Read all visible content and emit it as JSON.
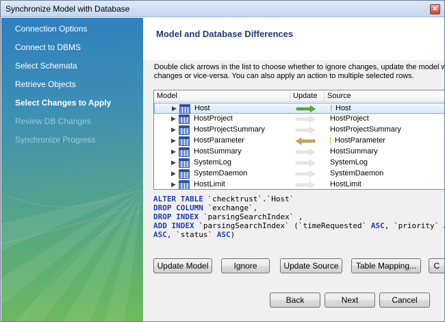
{
  "window": {
    "title": "Synchronize Model with Database",
    "close_glyph": "✕"
  },
  "sidebar": {
    "steps": [
      {
        "label": "Connection Options",
        "state": "done"
      },
      {
        "label": "Connect to DBMS",
        "state": "done"
      },
      {
        "label": "Select Schemata",
        "state": "done"
      },
      {
        "label": "Retrieve Objects",
        "state": "done"
      },
      {
        "label": "Select Changes to Apply",
        "state": "active"
      },
      {
        "label": "Review DB Changes",
        "state": "disabled"
      },
      {
        "label": "Synchronize Progress",
        "state": "disabled"
      }
    ]
  },
  "header": {
    "title": "Model and Database Differences"
  },
  "description": {
    "line1": "Double click arrows in the list to choose whether to ignore changes, update the model w",
    "line2": "changes or vice-versa. You can also apply an action to multiple selected rows."
  },
  "tree": {
    "columns": {
      "model": "Model",
      "update": "Update",
      "source": "Source"
    },
    "rows": [
      {
        "model": "Host",
        "source": "Host",
        "direction": "right",
        "warning": true,
        "selected": true
      },
      {
        "model": "HostProject",
        "source": "HostProject",
        "direction": "none",
        "warning": false,
        "selected": false
      },
      {
        "model": "HostProjectSummary",
        "source": "HostProjectSummary",
        "direction": "none",
        "warning": false,
        "selected": false
      },
      {
        "model": "HostParameter",
        "source": "HostParameter",
        "direction": "left",
        "warning": true,
        "selected": false
      },
      {
        "model": "HostSummary",
        "source": "HostSummary",
        "direction": "none",
        "warning": false,
        "selected": false
      },
      {
        "model": "SystemLog",
        "source": "SystemLog",
        "direction": "none",
        "warning": false,
        "selected": false
      },
      {
        "model": "SystemDaemon",
        "source": "SystemDaemon",
        "direction": "none",
        "warning": false,
        "selected": false
      },
      {
        "model": "HostLimit",
        "source": "HostLimit",
        "direction": "none",
        "warning": false,
        "selected": false
      }
    ]
  },
  "sql": {
    "l1_kw": "ALTER TABLE",
    "l1_rest": " `checktrust`.`Host`",
    "l2_kw": "DROP COLUMN",
    "l2_rest": " `exchange`,",
    "l3_kw": "DROP INDEX",
    "l3_rest": " `parsingSearchIndex` ,",
    "l4_kw": "ADD INDEX",
    "l4_a": " `parsingSearchIndex` (`timeRequested` ",
    "l4_asc1": "ASC",
    "l4_b": ", `priority` ",
    "l4_asc2": "A",
    "l5_asc3": "ASC",
    "l5_b": ", `status` ",
    "l5_asc4": "ASC",
    "l5_c": ")"
  },
  "actions": {
    "update_model": "Update Model",
    "ignore": "Ignore",
    "update_source": "Update Source",
    "table_mapping": "Table Mapping...",
    "cut_off": "C"
  },
  "nav": {
    "back": "Back",
    "next": "Next",
    "cancel": "Cancel"
  },
  "colors": {
    "arrow_right": "#4cae3a",
    "arrow_left": "#d6a54a",
    "arrow_none": "#e6e6e6",
    "warning": "#e8b400"
  }
}
